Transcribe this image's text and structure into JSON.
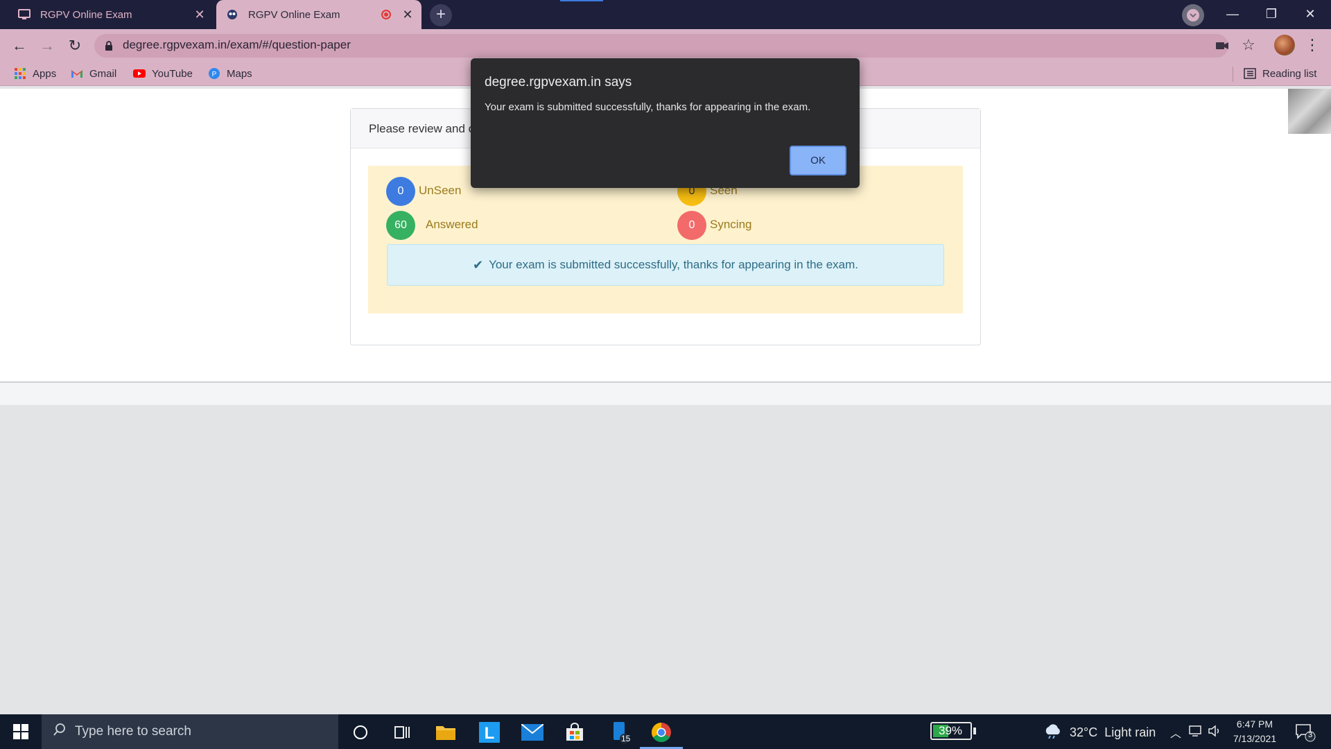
{
  "browser": {
    "tabs": [
      {
        "title": "RGPV Online Exam",
        "close": "✕"
      },
      {
        "title": "RGPV Online Exam",
        "close": "✕"
      }
    ],
    "new_tab": "+",
    "url": "degree.rgpvexam.in/exam/#/question-paper",
    "bookmarks": [
      {
        "label": "Apps",
        "icon": "apps-grid-icon"
      },
      {
        "label": "Gmail",
        "icon": "gmail-icon"
      },
      {
        "label": "YouTube",
        "icon": "youtube-icon"
      },
      {
        "label": "Maps",
        "icon": "maps-icon"
      }
    ],
    "reading_list": "Reading list",
    "accent_color": "#d9b3c5",
    "titlebar_color": "#1e1f3b"
  },
  "page": {
    "panel_heading": "Please review and c",
    "stats": {
      "unseen": {
        "count": "0",
        "label": "UnSeen",
        "color": "#3d7be0"
      },
      "seen": {
        "count": "0",
        "label": "Seen",
        "color": "#f6bd12"
      },
      "answered": {
        "count": "60",
        "label": "Answered",
        "color": "#36b061"
      },
      "syncing": {
        "count": "0",
        "label": "Syncing",
        "color": "#f26a6a"
      }
    },
    "success_message": "Your exam is submitted successfully, thanks for appearing in the exam."
  },
  "dialog": {
    "title": "degree.rgpvexam.in says",
    "message": "Your exam is submitted successfully, thanks for appearing in the exam.",
    "ok_label": "OK"
  },
  "taskbar": {
    "search_placeholder": "Type here to search",
    "store_badge": "15",
    "battery": "39%",
    "weather": "32°C  Light rain",
    "time": "6:47 PM",
    "date": "7/13/2021",
    "notifications": "3"
  }
}
